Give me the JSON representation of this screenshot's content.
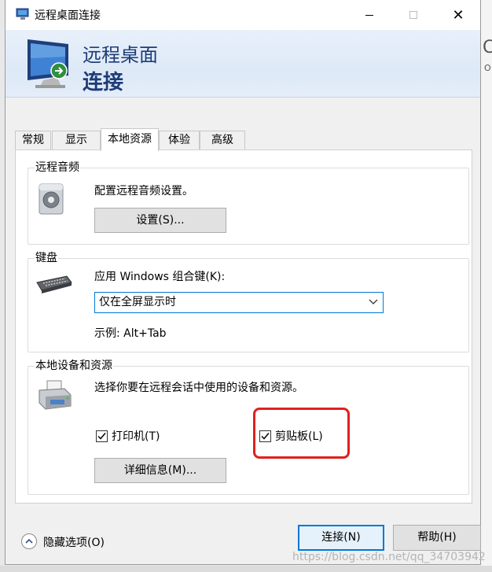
{
  "window": {
    "title": "远程桌面连接",
    "minimize": "minimize",
    "maximize": "maximize",
    "close": "✕"
  },
  "banner": {
    "line1": "远程桌面",
    "line2": "连接"
  },
  "tabs": [
    {
      "label": "常规"
    },
    {
      "label": "显示"
    },
    {
      "label": "本地资源",
      "active": true
    },
    {
      "label": "体验"
    },
    {
      "label": "高级"
    }
  ],
  "audio": {
    "group_label": "远程音频",
    "description": "配置远程音频设置。",
    "settings_button": "设置(S)..."
  },
  "keyboard": {
    "group_label": "键盘",
    "prompt": "应用 Windows 组合键(K):",
    "selected_option": "仅在全屏显示时",
    "example": "示例: Alt+Tab"
  },
  "devices": {
    "group_label": "本地设备和资源",
    "description": "选择你要在远程会话中使用的设备和资源。",
    "printer_label": "打印机(T)",
    "printer_checked": true,
    "clipboard_label": "剪贴板(L)",
    "clipboard_checked": true,
    "details_button": "详细信息(M)..."
  },
  "footer": {
    "hide_options": "隐藏选项(O)",
    "connect_button": "连接(N)",
    "help_button": "帮助(H)"
  },
  "watermark": "https://blog.csdn.net/qq_34703942",
  "colors": {
    "accent": "#0078d7",
    "banner_text": "#1d3c78",
    "highlight_box": "#e0201f"
  }
}
